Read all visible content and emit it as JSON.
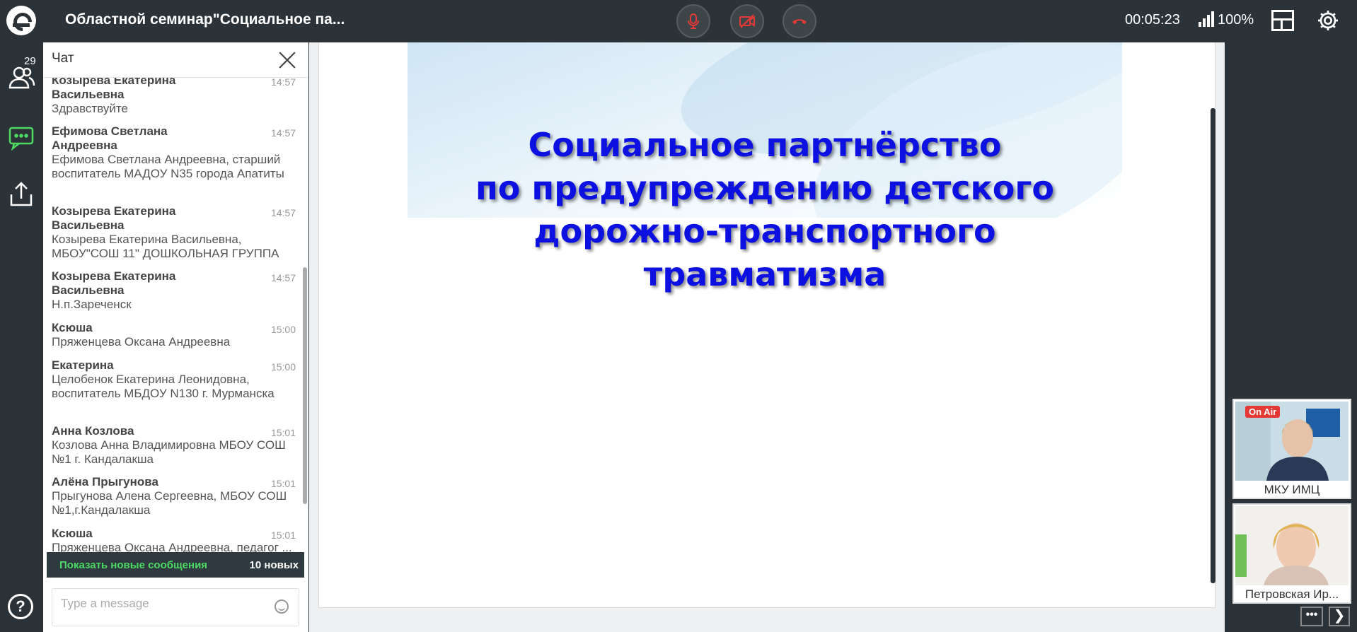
{
  "header": {
    "title": "Областной семинар\"Социальное па...",
    "timer": "00:05:23",
    "quality": "100%"
  },
  "colors": {
    "topbar": "#2b3238",
    "mic_red": "#e53935",
    "chat_green": "#4cd964",
    "slide_title_blue": "#0c10e0"
  },
  "icons": {
    "rail": [
      "users-icon",
      "chat-icon",
      "share-icon",
      "help-icon"
    ],
    "controls": [
      "microphone-off-icon",
      "camera-off-icon",
      "hangup-icon"
    ]
  },
  "rail": {
    "participants_count": "29",
    "help_label": "?"
  },
  "chat": {
    "title": "Чат",
    "messages": [
      {
        "author": "Козырева Екатерина Васильевна",
        "time": "14:57",
        "text": "Здравствуйте"
      },
      {
        "author": "Ефимова Светлана Андреевна",
        "time": "14:57",
        "text": "Ефимова Светлана Андреевна, старший воспитатель МАДОУ N35 города Апатиты"
      },
      {
        "author": "Козырева Екатерина Васильевна",
        "time": "14:57",
        "text": "Козырева Екатерина Васильевна, МБОУ\"СОШ 11\" ДОШКОЛЬНАЯ ГРУППА"
      },
      {
        "author": "Козырева Екатерина Васильевна",
        "time": "14:57",
        "text": "Н.п.Зареченск"
      },
      {
        "author": "Ксюша",
        "time": "15:00",
        "text": "Пряженцева Оксана Андреевна"
      },
      {
        "author": "Екатерина",
        "time": "15:00",
        "text": "Целобенок Екатерина Леонидовна, воспитатель МБДОУ N130 г. Мурманска"
      },
      {
        "author": "Анна Козлова",
        "time": "15:01",
        "text": "Козлова Анна Владимировна МБОУ СОШ №1 г. Кандалакша"
      },
      {
        "author": "Алёна Прыгунова",
        "time": "15:01",
        "text": "Прыгунова Алена Сергеевна, МБОУ СОШ №1,г.Кандалакша"
      },
      {
        "author": "Ксюша",
        "time": "15:01",
        "text": "Пряженцева Оксана Андреевна, педагог ... МБОУ РСОШ им. В.С.Воронина, пгт. Ревда"
      }
    ],
    "show_new": "Показать новые сообщения",
    "new_count": "10 новых",
    "input_placeholder": "Type a message"
  },
  "slide": {
    "title_lines": [
      "Социальное партнёрство",
      "по предупреждению детского",
      "дорожно-транспортного",
      "травматизма"
    ]
  },
  "videos": [
    {
      "name": "МКУ ИМЦ",
      "badge": "On Air"
    },
    {
      "name": "Петровская Ир..."
    }
  ],
  "controls": {
    "more": "•••",
    "next": "❯"
  }
}
